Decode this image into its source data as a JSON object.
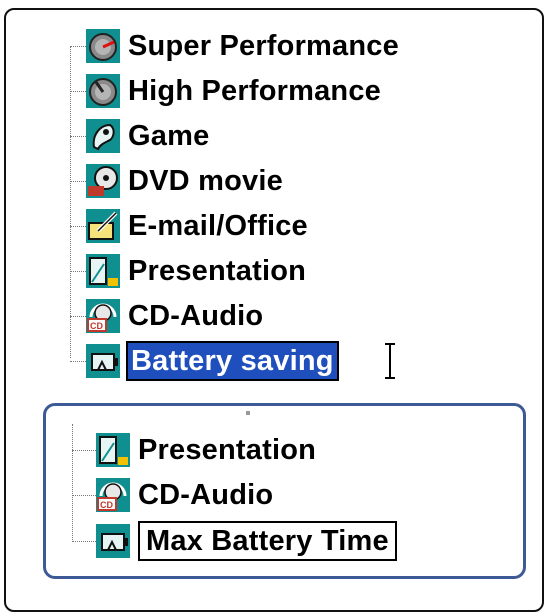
{
  "tree": {
    "items": [
      {
        "label": "Super Performance",
        "icon": "gauge-icon"
      },
      {
        "label": "High Performance",
        "icon": "gauge-icon"
      },
      {
        "label": "Game",
        "icon": "game-icon"
      },
      {
        "label": "DVD movie",
        "icon": "dvd-icon"
      },
      {
        "label": "E-mail/Office",
        "icon": "email-office-icon"
      },
      {
        "label": "Presentation",
        "icon": "presentation-icon"
      },
      {
        "label": "CD-Audio",
        "icon": "cd-audio-icon"
      },
      {
        "label": "Battery saving",
        "icon": "battery-icon",
        "state": "selected-editing"
      }
    ]
  },
  "callout": {
    "items": [
      {
        "label": "Presentation",
        "icon": "presentation-icon"
      },
      {
        "label": "CD-Audio",
        "icon": "cd-audio-icon"
      },
      {
        "label": "Max Battery Time",
        "icon": "battery-icon",
        "state": "editing"
      }
    ]
  },
  "colors": {
    "selection": "#1e4fbd",
    "callout_border": "#3d5a96",
    "icon_teal": "#0f8f8f"
  }
}
